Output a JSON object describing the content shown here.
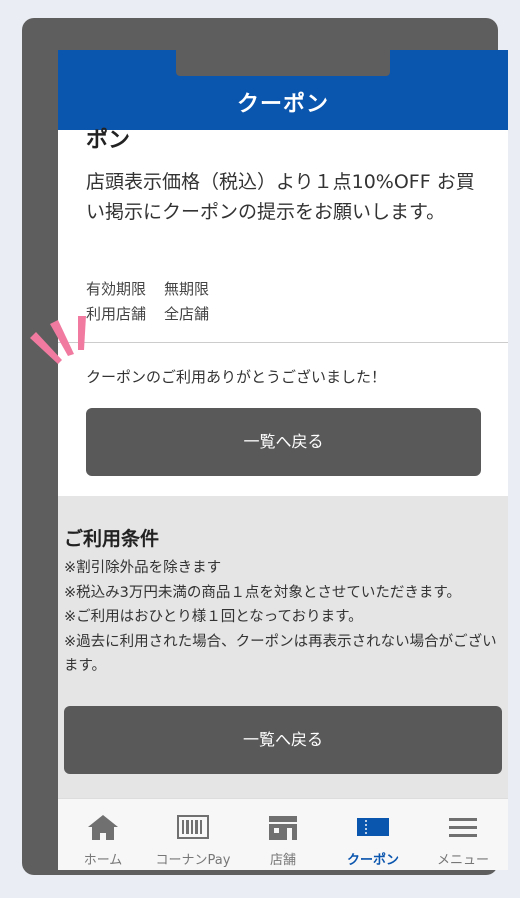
{
  "header": {
    "title": "クーポン"
  },
  "coupon": {
    "title_fragment": "ポン",
    "description": "店頭表示価格（税込）より１点10%OFF お買い掲示にクーポンの提示をお願いします。",
    "validity": {
      "label": "有効期限",
      "value": "無期限"
    },
    "stores": {
      "label": "利用店舗",
      "value": "全店舗"
    },
    "thanks_message": "クーポンのご利用ありがとうございました！",
    "back_button_label": "一覧へ戻る"
  },
  "conditions": {
    "title": "ご利用条件",
    "items": [
      "※割引除外品を除きます",
      "※税込み3万円未満の商品１点を対象とさせていただきます。",
      "※ご利用はおひとり様１回となっております。",
      "※過去に利用された場合、クーポンは再表示されない場合がございます。"
    ],
    "back_button_label": "一覧へ戻る"
  },
  "tabbar": {
    "items": [
      {
        "label": "ホーム",
        "icon": "home-icon"
      },
      {
        "label": "コーナンPay",
        "icon": "barcode-icon"
      },
      {
        "label": "店舗",
        "icon": "store-icon"
      },
      {
        "label": "クーポン",
        "icon": "coupon-icon",
        "active": true
      },
      {
        "label": "メニュー",
        "icon": "menu-icon"
      }
    ]
  },
  "colors": {
    "brand": "#0a55ae",
    "button": "#595959",
    "accent": "#f07aa0"
  }
}
